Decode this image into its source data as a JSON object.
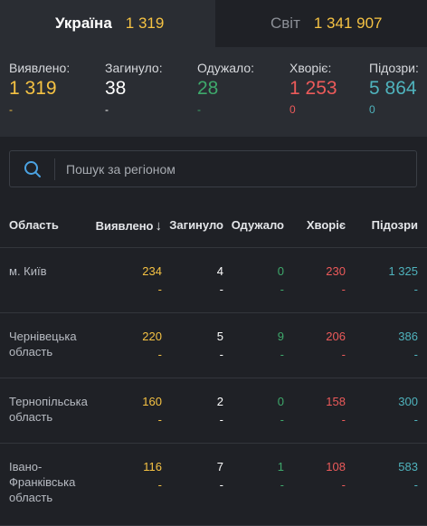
{
  "tabs": [
    {
      "label": "Україна",
      "count": "1 319"
    },
    {
      "label": "Світ",
      "count": "1 341 907"
    }
  ],
  "summary": [
    {
      "label": "Виявлено:",
      "value": "1 319",
      "delta": "-",
      "color": "#f5c243",
      "delta_color": "#f5c243"
    },
    {
      "label": "Загинуло:",
      "value": "38",
      "delta": "-",
      "color": "#ffffff",
      "delta_color": "#ffffff"
    },
    {
      "label": "Одужало:",
      "value": "28",
      "delta": "-",
      "color": "#3ea86b",
      "delta_color": "#3ea86b"
    },
    {
      "label": "Хворіє:",
      "value": "1 253",
      "delta": "0",
      "color": "#ec5a5a",
      "delta_color": "#ec5a5a"
    },
    {
      "label": "Підозри:",
      "value": "5 864",
      "delta": "0",
      "color": "#4fb3bd",
      "delta_color": "#4fb3bd"
    }
  ],
  "search": {
    "placeholder": "Пошук за регіоном",
    "icon": "search-icon"
  },
  "table": {
    "headers": {
      "region": "Область",
      "confirmed": "Виявлено",
      "sort_icon": "↓",
      "dead": "Загинуло",
      "recovered": "Одужало",
      "sick": "Хворіє",
      "suspected": "Підозри"
    },
    "rows": [
      {
        "region": "м. Київ",
        "confirmed": "234",
        "dead": "4",
        "recovered": "0",
        "sick": "230",
        "suspected": "1 325",
        "d_confirmed": "-",
        "d_dead": "-",
        "d_recovered": "-",
        "d_sick": "-",
        "d_suspected": "-"
      },
      {
        "region": "Чернівецька область",
        "confirmed": "220",
        "dead": "5",
        "recovered": "9",
        "sick": "206",
        "suspected": "386",
        "d_confirmed": "-",
        "d_dead": "-",
        "d_recovered": "-",
        "d_sick": "-",
        "d_suspected": "-"
      },
      {
        "region": "Тернопільська область",
        "confirmed": "160",
        "dead": "2",
        "recovered": "0",
        "sick": "158",
        "suspected": "300",
        "d_confirmed": "-",
        "d_dead": "-",
        "d_recovered": "-",
        "d_sick": "-",
        "d_suspected": "-"
      },
      {
        "region": "Івано-Франківська область",
        "confirmed": "116",
        "dead": "7",
        "recovered": "1",
        "sick": "108",
        "suspected": "583",
        "d_confirmed": "-",
        "d_dead": "-",
        "d_recovered": "-",
        "d_sick": "-",
        "d_suspected": "-"
      }
    ]
  }
}
